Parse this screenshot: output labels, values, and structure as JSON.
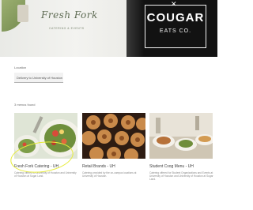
{
  "banner": {
    "brand_script": "Fresh Fork",
    "brand_sub": "CATERING & EVENTS",
    "cougar_title": "COUGAR",
    "cougar_sub": "EATS CO."
  },
  "location": {
    "label": "Location",
    "value": "Delivery to University of Houston"
  },
  "results": {
    "count_label": "3 menus found",
    "cards": [
      {
        "title": "Fresh Fork Catering - UH",
        "desc": "Catering offered to University of Houston and University of Houston at Sugar Land."
      },
      {
        "title": "Retail Brands - UH",
        "desc": "Catering provided by the on-campus locations at University of Houston."
      },
      {
        "title": "Student Cxog Menu - UH",
        "desc": "Catering offered for Student Organizations and Events at University of Houston and University of Houston at Sugar Land."
      }
    ]
  },
  "colors": {
    "highlight": "#e7ec3c",
    "banner_dark": "#121212"
  }
}
